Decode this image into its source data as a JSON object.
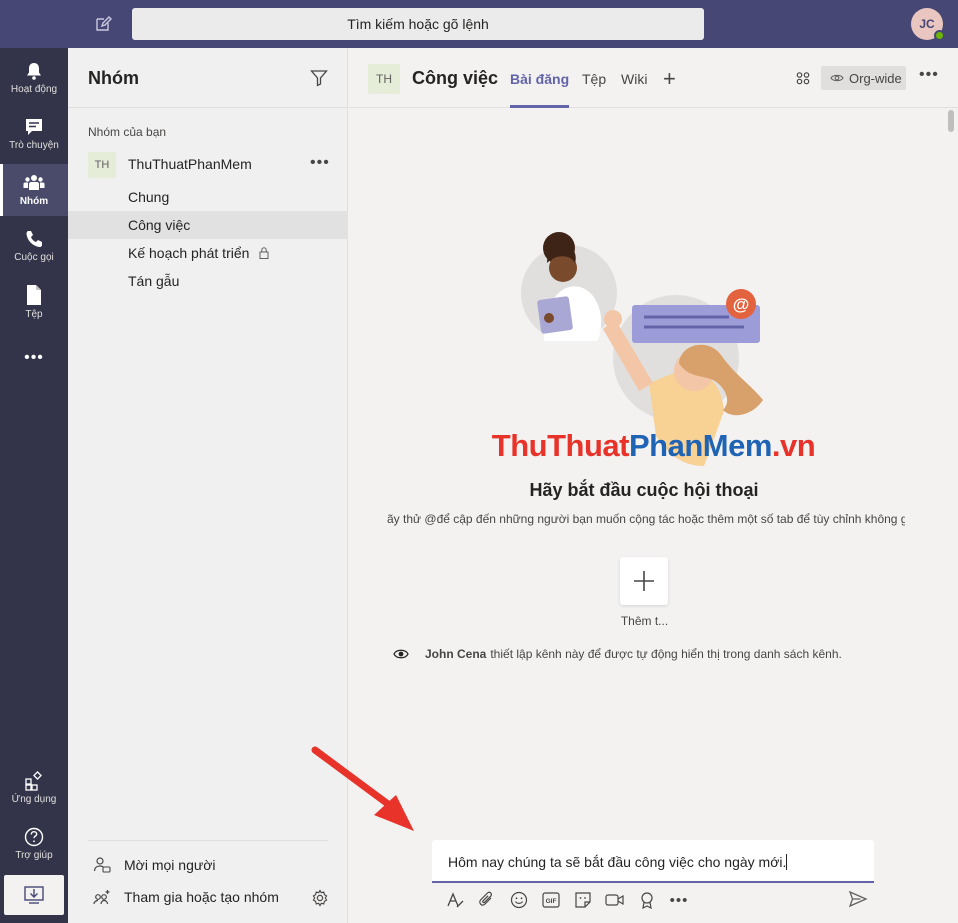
{
  "search": {
    "placeholder": "Tìm kiếm hoặc gõ lệnh"
  },
  "user": {
    "initials": "JC"
  },
  "rail": {
    "items": [
      {
        "label": "Hoạt động",
        "icon": "bell-icon"
      },
      {
        "label": "Trò chuyện",
        "icon": "chat-icon"
      },
      {
        "label": "Nhóm",
        "icon": "teams-icon"
      },
      {
        "label": "Cuộc gọi",
        "icon": "phone-icon"
      },
      {
        "label": "Tệp",
        "icon": "file-icon"
      },
      {
        "label": "•••",
        "icon": "more-icon"
      },
      {
        "label": "Ứng dụng",
        "icon": "apps-icon"
      },
      {
        "label": "Trợ giúp",
        "icon": "help-icon"
      }
    ],
    "download_icon": "download-icon"
  },
  "panel": {
    "title": "Nhóm",
    "section": "Nhóm của bạn",
    "team": {
      "badge": "TH",
      "name": "ThuThuatPhanMem",
      "more": "•••"
    },
    "channels": [
      {
        "name": "Chung"
      },
      {
        "name": "Công việc"
      },
      {
        "name": "Kế hoạch phát triển"
      },
      {
        "name": "Tán gẫu"
      }
    ],
    "invite_label": "Mời mọi người",
    "join_label": "Tham gia hoặc tạo nhóm"
  },
  "channel": {
    "badge": "TH",
    "title": "Công việc",
    "tabs": [
      {
        "label": "Bài đăng"
      },
      {
        "label": "Tệp"
      },
      {
        "label": "Wiki"
      }
    ],
    "add_tab": "+",
    "orgwide": "Org-wide",
    "more": "•••"
  },
  "watermark": {
    "part1": "ThuThuat",
    "part2": "PhanMem",
    "part3": ".vn"
  },
  "empty_state": {
    "title": "Hãy bắt đầu cuộc hội thoại",
    "subtitle": "ãy thử @để cập đến những người bạn muốn cộng tác hoặc thêm một số tab để tùy chỉnh không g",
    "add_label": "Thêm t..."
  },
  "system_message": {
    "author": "John Cena",
    "text": "thiết lập kênh này để được tự động hiển thị trong danh sách kênh."
  },
  "compose": {
    "text": "Hôm nay chúng ta sẽ bắt đầu công việc cho ngày mới."
  },
  "colors": {
    "accent": "#6264a7",
    "topbar": "#464775",
    "rail": "#33344a",
    "arrow": "#e8332b"
  }
}
